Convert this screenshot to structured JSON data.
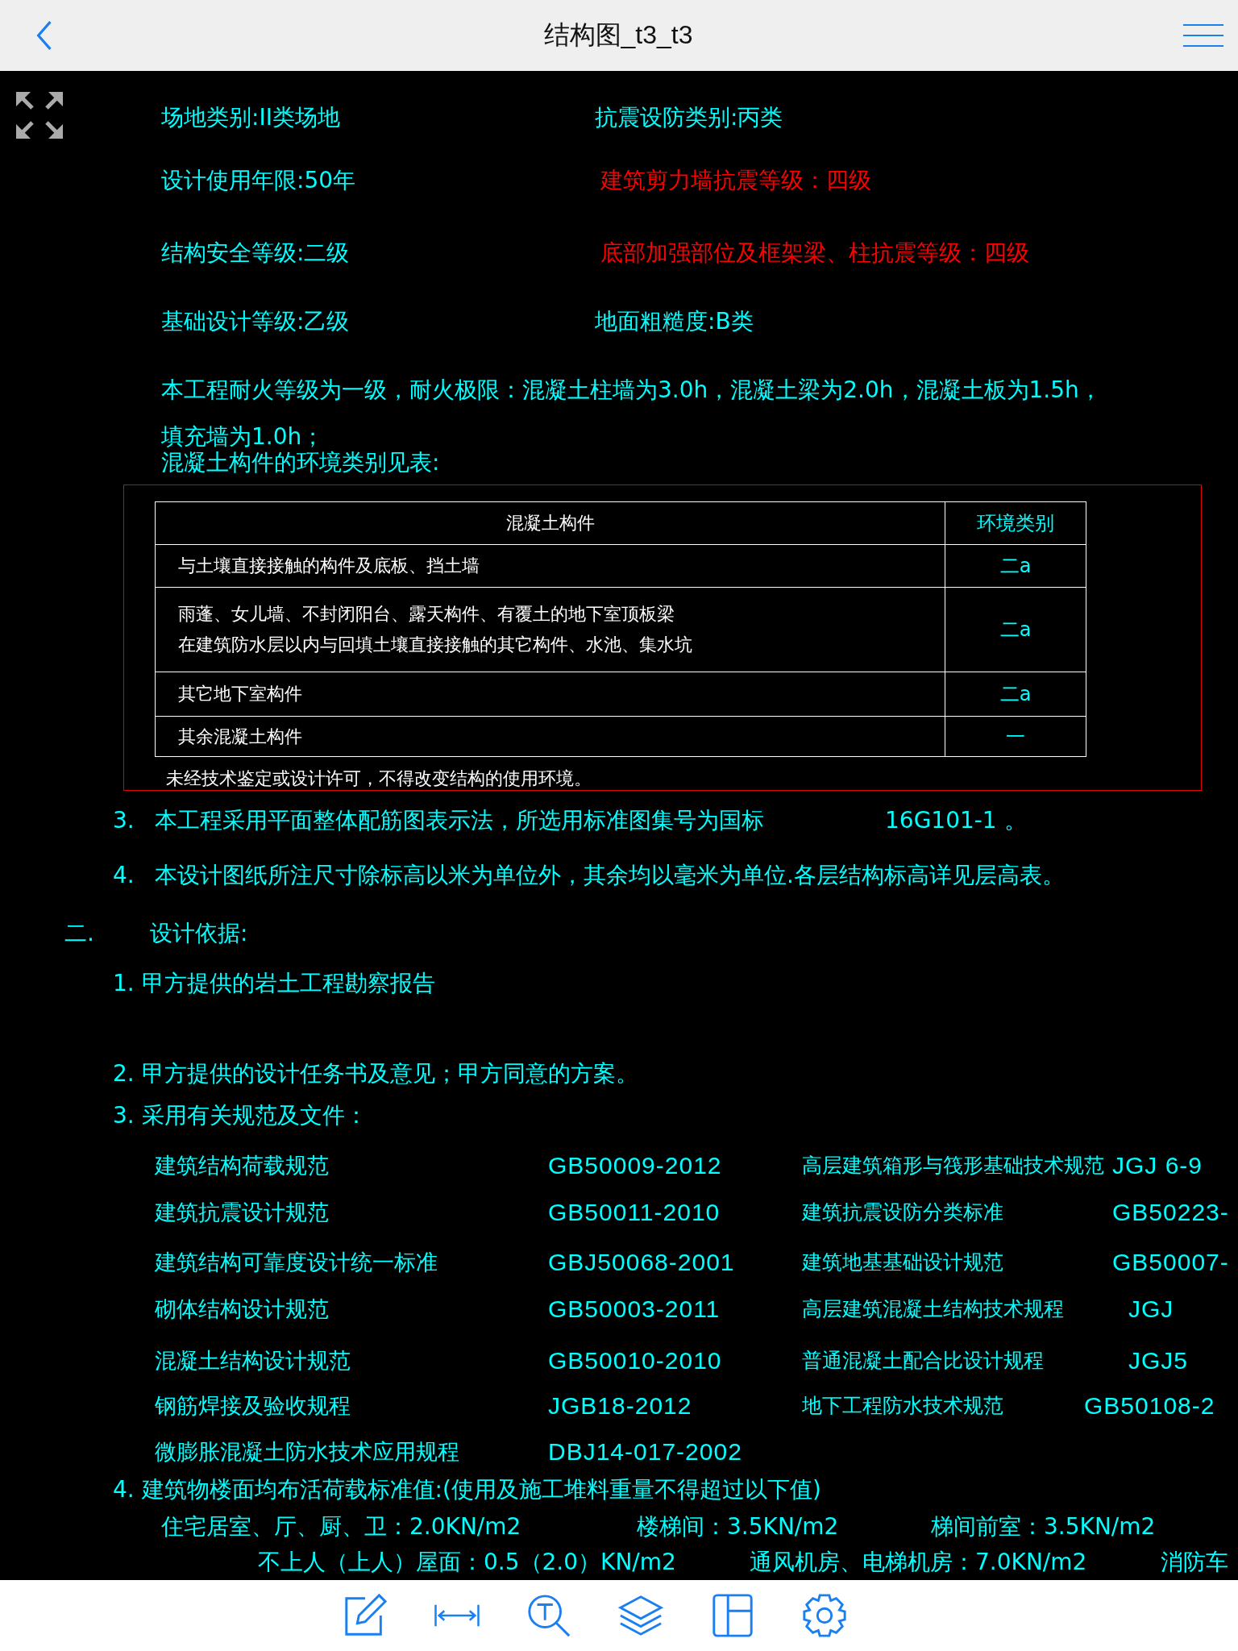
{
  "header": {
    "title": "结构图_t3_t3"
  },
  "notes": [
    {
      "text": "场地类别:II类场地",
      "color": "#00ffff"
    },
    {
      "text": "抗震设防类别:丙类",
      "color": "#00ffff"
    },
    {
      "text": "设计使用年限:50年",
      "color": "#00ffff"
    },
    {
      "text": "建筑剪力墙抗震等级：四级",
      "color": "#ff0000"
    },
    {
      "text": "结构安全等级:二级",
      "color": "#00ffff"
    },
    {
      "text": "底部加强部位及框架梁、柱抗震等级：四级",
      "color": "#ff0000"
    },
    {
      "text": "基础设计等级:乙级",
      "color": "#00ffff"
    },
    {
      "text": "地面粗糙度:B类",
      "color": "#00ffff"
    },
    {
      "text": "本工程耐火等级为一级，耐火极限：混凝土柱墙为3.0h，混凝土梁为2.0h，混凝土板为1.5h，",
      "color": "#00ffff"
    },
    {
      "text": "填充墙为1.0h；",
      "color": "#00ffff"
    },
    {
      "text": "混凝土构件的环境类别见表:",
      "color": "#00ffff"
    }
  ],
  "table": {
    "columns": [
      "混凝土构件",
      "环境类别"
    ],
    "rows": [
      {
        "component": [
          "与土壤直接接触的构件及底板、挡土墙"
        ],
        "category": "二a"
      },
      {
        "component": [
          "雨蓬、女儿墙、不封闭阳台、露天构件、有覆土的地下室顶板梁",
          "在建筑防水层以内与回填土壤直接接触的其它构件、水池、集水坑"
        ],
        "category": "二a"
      },
      {
        "component": [
          "其它地下室构件"
        ],
        "category": "二a"
      },
      {
        "component": [
          "其余混凝土构件"
        ],
        "category": "一"
      }
    ],
    "footnote": "未经技术鉴定或设计许可，不得改变结构的使用环境。"
  },
  "sections": [
    {
      "text": "3.",
      "color": "#00ffff"
    },
    {
      "text": "本工程采用平面整体配筋图表示法，所选用标准图集号为国标",
      "color": "#00ffff"
    },
    {
      "text": "16G101-1 。",
      "color": "#00ffff"
    },
    {
      "text": "4.",
      "color": "#00ffff"
    },
    {
      "text": "本设计图纸所注尺寸除标高以米为单位外，其余均以毫米为单位.各层结构标高详见层高表。",
      "color": "#00ffff"
    },
    {
      "text": "二.",
      "color": "#00ffff"
    },
    {
      "text": "设计依据:",
      "color": "#00ffff"
    },
    {
      "text": "1. 甲方提供的岩土工程勘察报告",
      "color": "#00ffff"
    },
    {
      "text": "2. 甲方提供的设计任务书及意见；甲方同意的方案。",
      "color": "#00ffff"
    },
    {
      "text": "3. 采用有关规范及文件：",
      "color": "#00ffff"
    }
  ],
  "standards": [
    {
      "name": "建筑结构荷载规范",
      "code": "GB50009-2012",
      "right_name": "高层建筑箱形与筏形基础技术规范",
      "right_code": "JGJ 6-9"
    },
    {
      "name": "建筑抗震设计规范",
      "code": "GB50011-2010",
      "right_name": "建筑抗震设防分类标准",
      "right_code": "GB50223-"
    },
    {
      "name": "建筑结构可靠度设计统一标准",
      "code": "GBJ50068-2001",
      "right_name": "建筑地基基础设计规范",
      "right_code": "GB50007-"
    },
    {
      "name": "砌体结构设计规范",
      "code": "GB50003-2011",
      "right_name": "高层建筑混凝土结构技术规程",
      "right_code": "JGJ"
    },
    {
      "name": "混凝土结构设计规范",
      "code": "GB50010-2010",
      "right_name": "普通混凝土配合比设计规程",
      "right_code": "JGJ5"
    },
    {
      "name": "钢筋焊接及验收规程",
      "code": "JGB18-2012",
      "right_name": "地下工程防水技术规范",
      "right_code": "GB50108-2"
    },
    {
      "name": "微膨胀混凝土防水技术应用规程",
      "code": "DBJ14-017-2002"
    }
  ],
  "loads": [
    {
      "text": "4. 建筑物楼面均布活荷载标准值:(使用及施工堆料重量不得超过以下值)",
      "color": "#00ffff"
    },
    {
      "text": "住宅居室、厅、厨、卫：2.0KN/m2",
      "color": "#00ffff"
    },
    {
      "text": "楼梯间：3.5KN/m2",
      "color": "#00ffff"
    },
    {
      "text": "梯间前室：3.5KN/m2",
      "color": "#00ffff"
    },
    {
      "text": "不上人（上人）屋面：0.5（2.0）KN/m2",
      "color": "#00ffff"
    },
    {
      "text": "通风机房、电梯机房：7.0KN/m2",
      "color": "#00ffff"
    },
    {
      "text": "消防车",
      "color": "#00ffff"
    }
  ]
}
